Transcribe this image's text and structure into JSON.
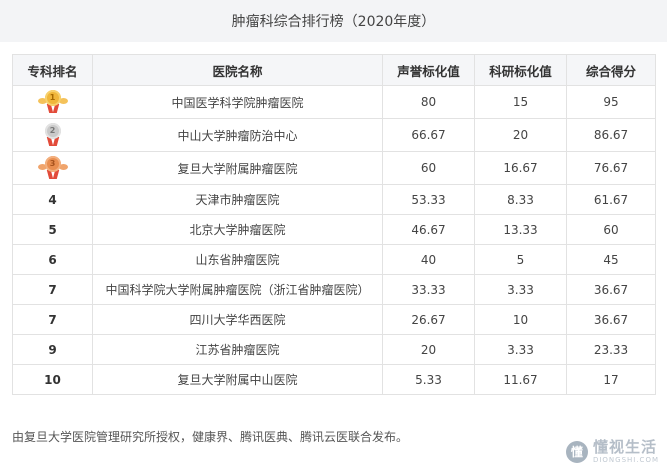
{
  "title": "肿瘤科综合排行榜（2020年度）",
  "columns": [
    "专科排名",
    "医院名称",
    "声誉标化值",
    "科研标化值",
    "综合得分"
  ],
  "rows": [
    {
      "rank": "1",
      "medal": "gold",
      "name": "中国医学科学院肿瘤医院",
      "reputation": "80",
      "research": "15",
      "score": "95"
    },
    {
      "rank": "2",
      "medal": "silver",
      "name": "中山大学肿瘤防治中心",
      "reputation": "66.67",
      "research": "20",
      "score": "86.67"
    },
    {
      "rank": "3",
      "medal": "bronze",
      "name": "复旦大学附属肿瘤医院",
      "reputation": "60",
      "research": "16.67",
      "score": "76.67"
    },
    {
      "rank": "4",
      "medal": "",
      "name": "天津市肿瘤医院",
      "reputation": "53.33",
      "research": "8.33",
      "score": "61.67"
    },
    {
      "rank": "5",
      "medal": "",
      "name": "北京大学肿瘤医院",
      "reputation": "46.67",
      "research": "13.33",
      "score": "60"
    },
    {
      "rank": "6",
      "medal": "",
      "name": "山东省肿瘤医院",
      "reputation": "40",
      "research": "5",
      "score": "45"
    },
    {
      "rank": "7",
      "medal": "",
      "name": "中国科学院大学附属肿瘤医院（浙江省肿瘤医院）",
      "reputation": "33.33",
      "research": "3.33",
      "score": "36.67"
    },
    {
      "rank": "7",
      "medal": "",
      "name": "四川大学华西医院",
      "reputation": "26.67",
      "research": "10",
      "score": "36.67"
    },
    {
      "rank": "9",
      "medal": "",
      "name": "江苏省肿瘤医院",
      "reputation": "20",
      "research": "3.33",
      "score": "23.33"
    },
    {
      "rank": "10",
      "medal": "",
      "name": "复旦大学附属中山医院",
      "reputation": "5.33",
      "research": "11.67",
      "score": "17"
    }
  ],
  "footer": "由复旦大学医院管理研究所授权，健康界、腾讯医典、腾讯云医联合发布。",
  "watermark": {
    "logo": "懂",
    "cn": "懂视生活",
    "en": "DIONGSHI.COM"
  }
}
